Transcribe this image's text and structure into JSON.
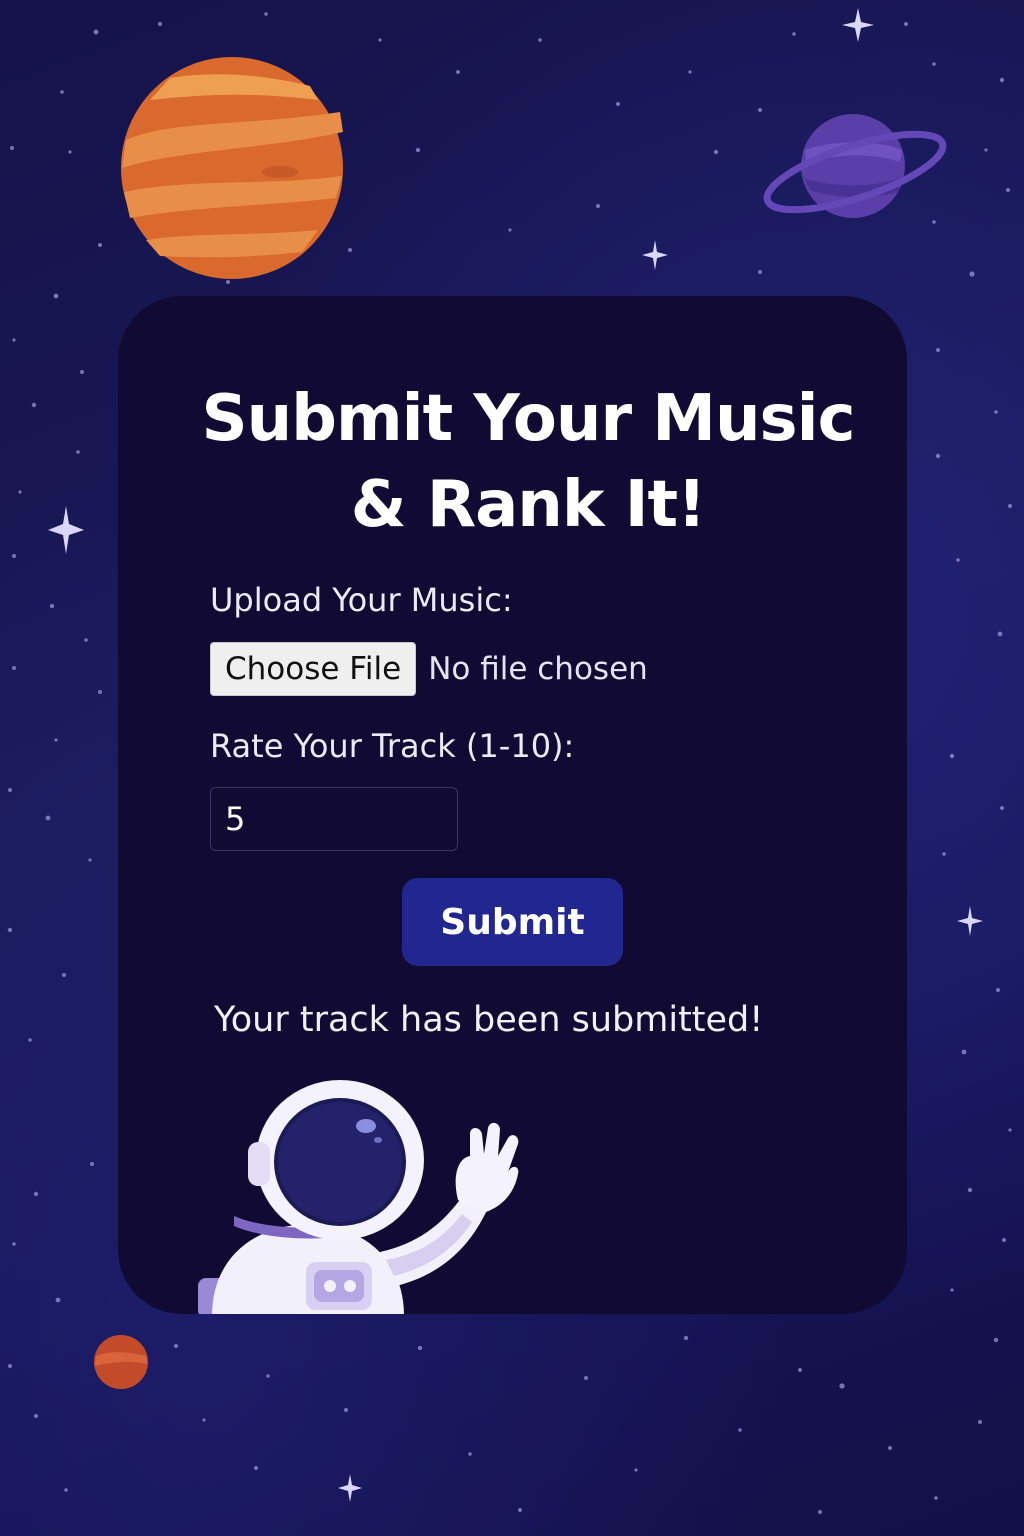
{
  "page": {
    "title_line_1": "Submit Your Music",
    "title_line_2": "& Rank It!"
  },
  "form": {
    "upload_label": "Upload Your Music:",
    "choose_file_label": "Choose File",
    "file_status": "No file chosen",
    "rating_label": "Rate Your Track (1-10):",
    "rating_value": "5",
    "submit_label": "Submit",
    "confirmation": "Your track has been submitted!"
  },
  "colors": {
    "background": "#16145a",
    "card": "#110b33",
    "submit_button": "#22278f",
    "text": "#ffffff"
  },
  "decorations": {
    "large_planet": "orange-planet-icon",
    "ringed_planet": "ringed-planet-icon",
    "small_planet": "red-planet-icon",
    "mascot": "astronaut-illustration",
    "stars": "sparkle-star-icon"
  }
}
